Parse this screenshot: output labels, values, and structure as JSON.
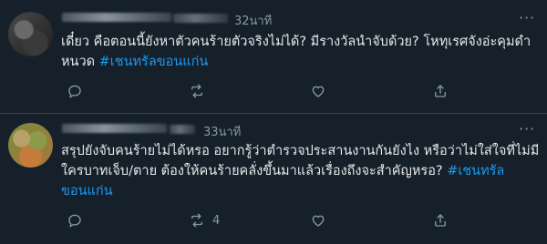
{
  "tweets": [
    {
      "time": "32นาที",
      "text_main": "เดี๋ยว คือตอนนี้ยังหาตัวคนร้ายตัวจริงไม่ได้? มีรางวัลนำจับด้วย? โหทุเรศจังอ่ะคุมดำหนวด ",
      "hashtag": "#เชนทรัลขอนแก่น",
      "reply_count": "",
      "retweet_count": "",
      "like_count": ""
    },
    {
      "time": "33นาที",
      "text_main": "สรุปยังจับคนร้ายไม่ได้หรอ อยากรู้ว่าตำรวจประสานงานกันยังไง หรือว่าไม่ใส่ใจที่ไม่มีใครบาทเจ็บ/ตาย ต้องให้คนร้ายคลั่งขึ้นมาแล้วเรื่องถึงจะสำคัญหรอ? ",
      "hashtag": "#เชนทรัลขอนแก่น",
      "reply_count": "",
      "retweet_count": "4",
      "like_count": ""
    }
  ],
  "icons": {
    "reply": "reply-icon",
    "retweet": "retweet-icon",
    "like": "like-icon",
    "share": "share-icon",
    "more": "more-icon"
  },
  "colors": {
    "background": "#15202b",
    "text": "#e7e9ea",
    "secondary": "#8b98a5",
    "hashtag": "#1d9bf0",
    "divider": "#38444d"
  }
}
